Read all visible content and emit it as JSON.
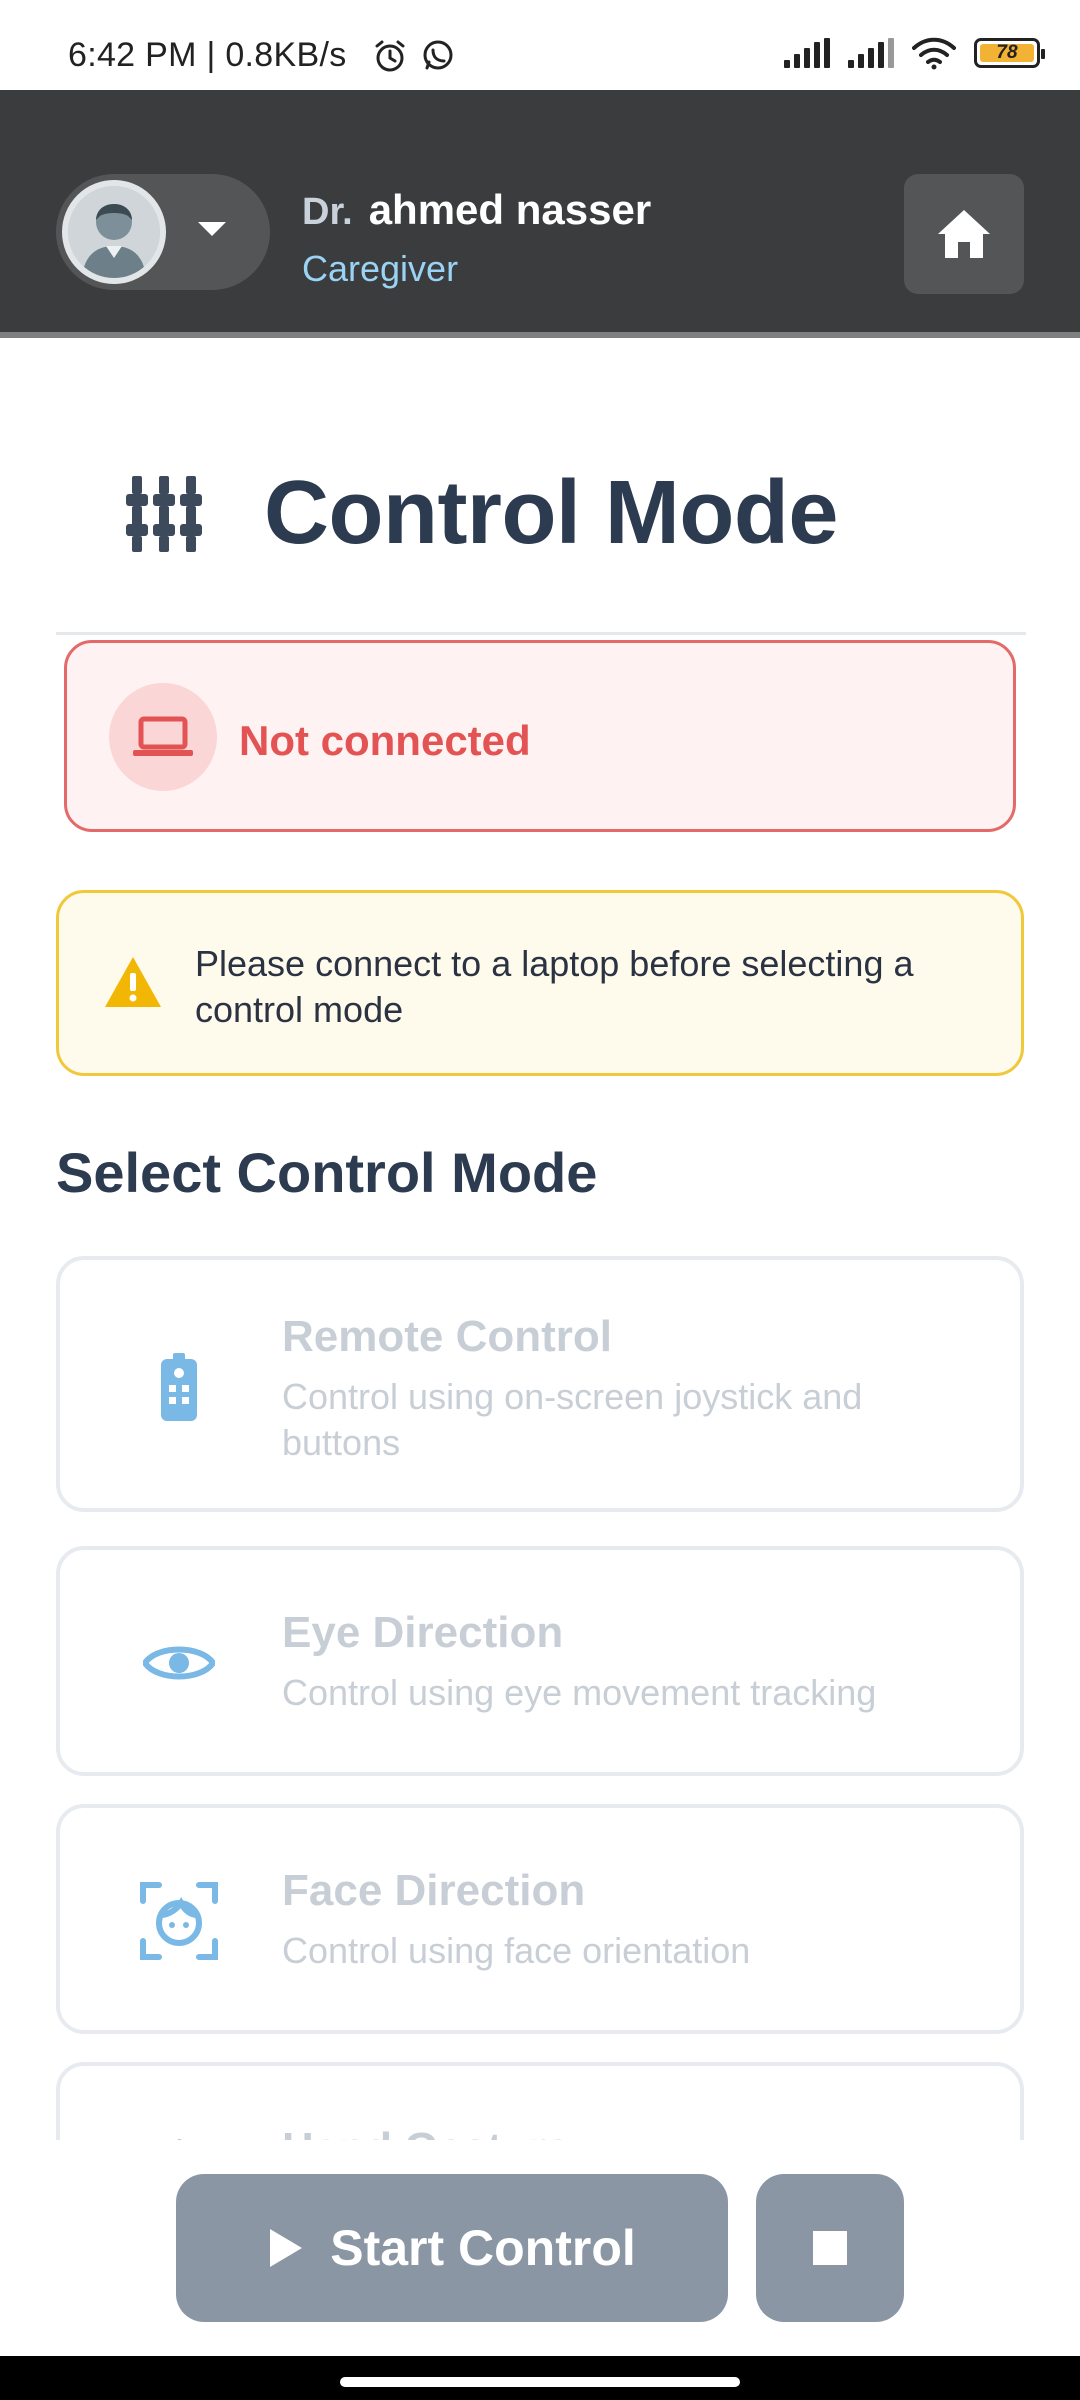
{
  "status_bar": {
    "time": "6:42 PM | 0.8KB/s",
    "battery": "78",
    "icons": [
      "alarm-icon",
      "whatsapp-icon",
      "signal-icon",
      "signal-icon",
      "wifi-icon",
      "battery-icon"
    ]
  },
  "header": {
    "prefix": "Dr.",
    "name": "ahmed nasser",
    "role": "Caregiver",
    "icons": [
      "avatar",
      "chevron-down-icon",
      "home-icon"
    ]
  },
  "page": {
    "title": "Control Mode",
    "title_icon": "sliders-icon"
  },
  "connection": {
    "status": "Not connected",
    "icon": "laptop-icon",
    "color": "#e35353"
  },
  "warning": {
    "text": "Please connect to a laptop before selecting a control mode",
    "icon": "warning-icon",
    "color": "#f0c83a"
  },
  "section": {
    "title": "Select Control Mode"
  },
  "modes": [
    {
      "title": "Remote Control",
      "description": "Control using on-screen joystick and buttons",
      "icon": "remote-icon"
    },
    {
      "title": "Eye Direction",
      "description": "Control using eye movement tracking",
      "icon": "eye-icon"
    },
    {
      "title": "Face Direction",
      "description": "Control using face orientation",
      "icon": "face-icon"
    },
    {
      "title": "Hand Gesture",
      "description": "",
      "icon": "hand-icon"
    }
  ],
  "actions": {
    "start_label": "Start Control",
    "start_icon": "play-icon",
    "stop_icon": "stop-icon"
  },
  "colors": {
    "header_bg": "#3b3c3d",
    "accent_blue": "#7ab8e6",
    "disabled_button": "#8a96a3"
  }
}
